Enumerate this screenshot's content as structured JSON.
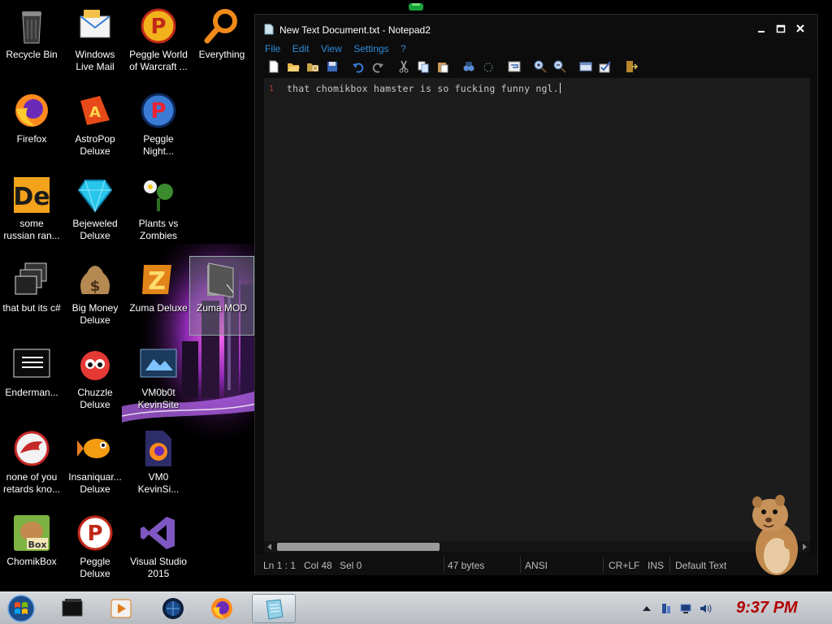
{
  "desktop": {
    "icons": [
      {
        "label": "Recycle Bin",
        "icon": "recycle-bin-icon"
      },
      {
        "label": "Windows\nLive Mail",
        "icon": "mail-icon"
      },
      {
        "label": "Peggle World\nof Warcraft ...",
        "icon": "peggle-icon"
      },
      {
        "label": "Everything",
        "icon": "magnifier-icon"
      },
      {
        "label": "Firefox",
        "icon": "firefox-icon"
      },
      {
        "label": "AstroPop\nDeluxe",
        "icon": "astropop-icon"
      },
      {
        "label": "Peggle\nNight...",
        "icon": "peggle-night-icon"
      },
      {
        "label": "some\nrussian ran...",
        "icon": "de-icon"
      },
      {
        "label": "Bejeweled\nDeluxe",
        "icon": "gem-icon"
      },
      {
        "label": "Plants vs\nZombies",
        "icon": "plant-icon"
      },
      {
        "label": "that but its c#",
        "icon": "windows-stack-icon"
      },
      {
        "label": "Big Money\nDeluxe",
        "icon": "money-bag-icon"
      },
      {
        "label": "Zuma Deluxe",
        "icon": "zuma-icon"
      },
      {
        "label": "Zuma MOD",
        "icon": "folder-icon"
      },
      {
        "label": "Enderman...",
        "icon": "terminal-icon"
      },
      {
        "label": "Chuzzle\nDeluxe",
        "icon": "chuzzle-icon"
      },
      {
        "label": "VM0b0t\nKevinSite",
        "icon": "vm-screen-icon"
      },
      {
        "label": "none of you\nretards kno...",
        "icon": "dragon-icon"
      },
      {
        "label": "Insaniquar...\nDeluxe",
        "icon": "fish-icon"
      },
      {
        "label": "VM0\nKevinSi...",
        "icon": "firefox-file-icon"
      },
      {
        "label": "ChomikBox",
        "icon": "chomikbox-icon"
      },
      {
        "label": "Peggle\nDeluxe",
        "icon": "peggle-deluxe-icon"
      },
      {
        "label": "Visual Studio\n2015",
        "icon": "visual-studio-icon"
      }
    ]
  },
  "window": {
    "title": "New Text Document.txt - Notepad2",
    "menu": [
      "File",
      "Edit",
      "View",
      "Settings",
      "?"
    ],
    "toolbar_icons": [
      "new-icon",
      "open-icon",
      "browse-icon",
      "save-icon",
      "undo-icon",
      "redo-icon",
      "cut-icon",
      "copy-icon",
      "paste-icon",
      "find-icon",
      "replace-icon",
      "wordwrap-icon",
      "zoom-in-icon",
      "zoom-out-icon",
      "schemes-icon",
      "customize-icon",
      "exit-icon"
    ],
    "editor": {
      "line_number": "1",
      "text": "that chomikbox hamster is so fucking funny ngl."
    },
    "status": {
      "position": "Ln 1 : 1",
      "column": "Col 48",
      "selection": "Sel 0",
      "size": "47 bytes",
      "encoding": "ANSI",
      "line_endings": "CR+LF",
      "insert_mode": "INS",
      "scheme": "Default Text"
    }
  },
  "taskbar": {
    "items": [
      "start-orb-icon",
      "black-window-icon",
      "media-player-icon",
      "globe-icon",
      "firefox-icon",
      "notepad2-icon"
    ],
    "tray_icons": [
      "show-hidden-icon",
      "device-icon",
      "network-icon",
      "volume-icon"
    ],
    "clock": "9:37 PM"
  },
  "colors": {
    "menu_text": "#2e8bd8",
    "clock": "#b10000",
    "editor_bg": "#1c1c1c"
  }
}
